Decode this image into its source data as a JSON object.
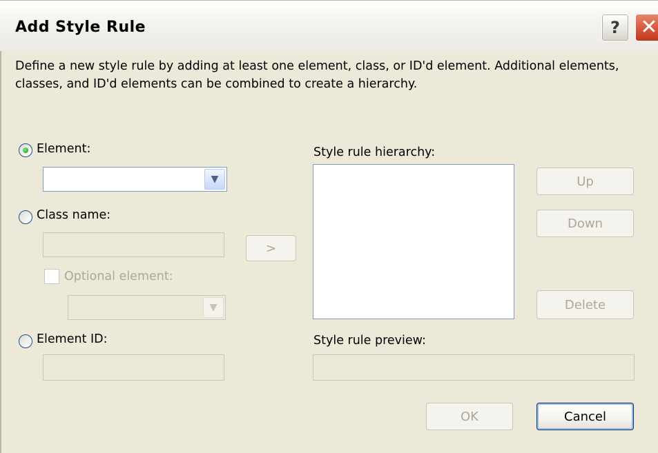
{
  "window": {
    "title": "Add Style Rule",
    "help_label": "?",
    "close_label": "✕"
  },
  "description": "Define a new style rule by adding at least one element, class, or ID'd element.  Additional elements, classes, and ID'd elements can be combined to create a hierarchy.",
  "form": {
    "element_label": "Element:",
    "element_value": "",
    "class_name_label": "Class name:",
    "class_name_value": "",
    "optional_element_label": "Optional element:",
    "optional_element_value": "",
    "element_id_label": "Element ID:",
    "element_id_value": "",
    "selected_option": "Element"
  },
  "add_button_label": ">",
  "hierarchy": {
    "label": "Style rule hierarchy:",
    "items": []
  },
  "buttons": {
    "up": "Up",
    "down": "Down",
    "delete": "Delete",
    "ok": "OK",
    "cancel": "Cancel"
  },
  "preview": {
    "label": "Style rule preview:",
    "value": ""
  },
  "icons": {
    "dropdown": "chevron-down-icon",
    "help": "help-icon",
    "close": "close-icon"
  }
}
